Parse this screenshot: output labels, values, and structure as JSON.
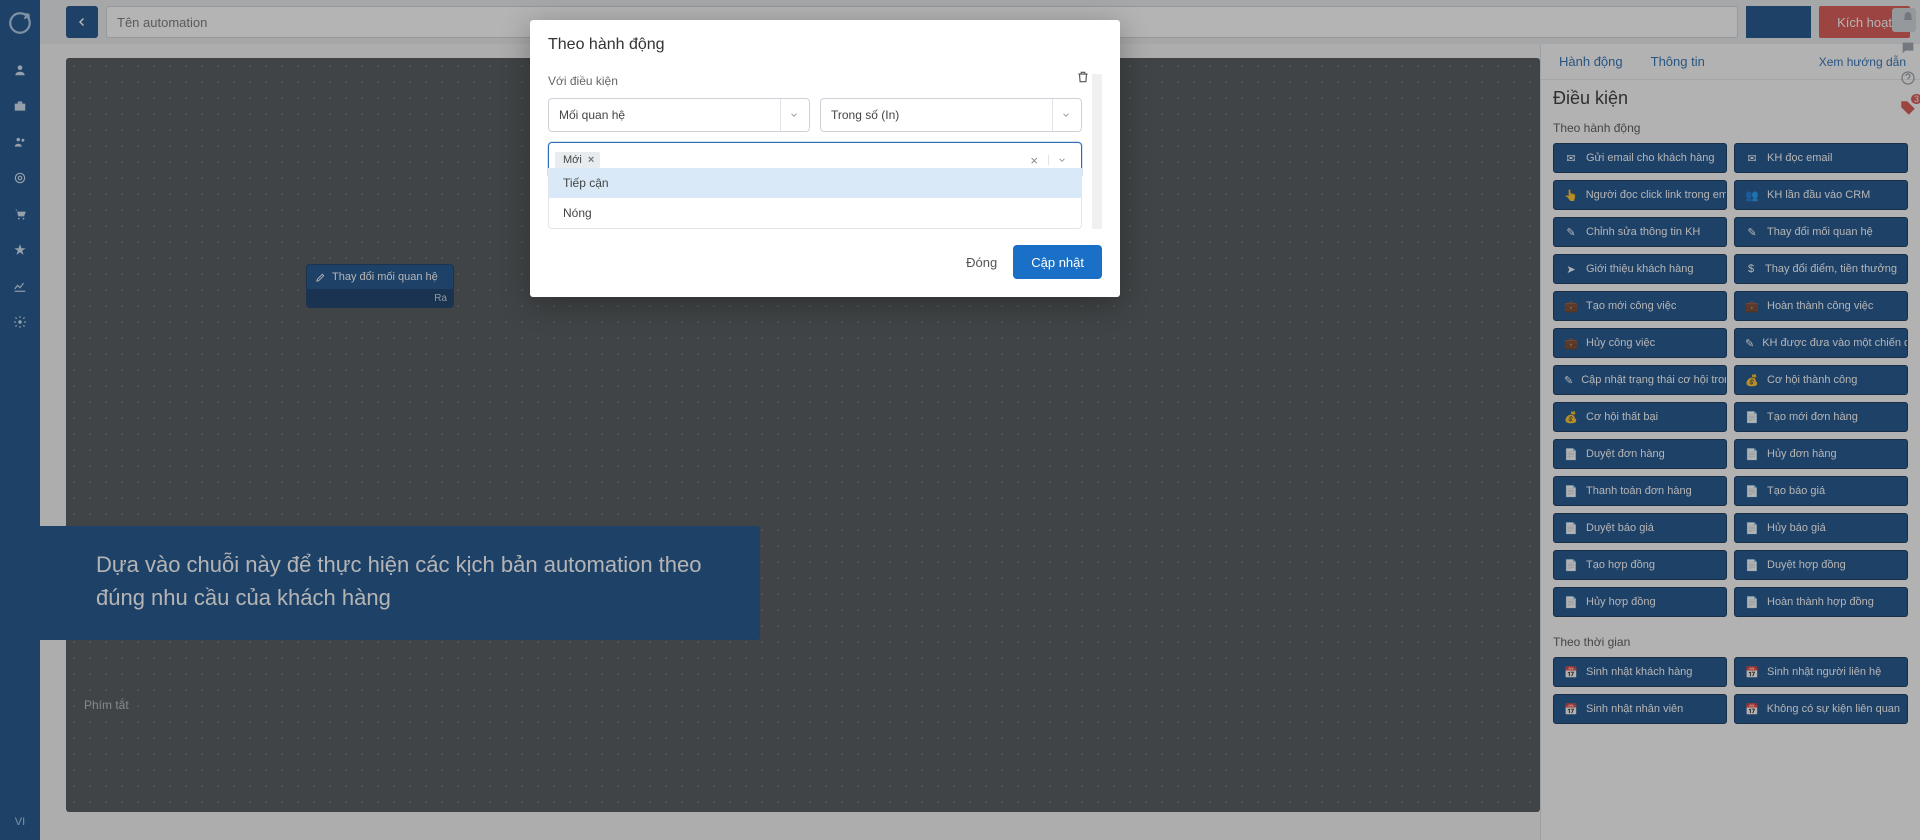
{
  "sidebar": {
    "lang": "VI"
  },
  "topbar": {
    "name_placeholder": "Tên automation",
    "activate": "Kích hoạt"
  },
  "canvas": {
    "node_label": "Thay đổi mối quan hệ",
    "node_port": "Ra",
    "shortcut": "Phím tắt"
  },
  "caption": "Dựa vào chuỗi này để thực hiện các kịch bản automation theo đúng nhu cầu của khách hàng",
  "panel": {
    "tabs": [
      "Hành động",
      "Thông tin"
    ],
    "help": "Xem hướng dẫn",
    "title": "Điều kiện",
    "section_action": "Theo hành động",
    "section_time": "Theo thời gian",
    "actions_col1": [
      {
        "icon": "✉",
        "label": "Gửi email cho khách hàng"
      },
      {
        "icon": "👆",
        "label": "Người đọc click link trong email"
      },
      {
        "icon": "✎",
        "label": "Chỉnh sửa thông tin KH"
      },
      {
        "icon": "➤",
        "label": "Giới thiệu khách hàng"
      },
      {
        "icon": "💼",
        "label": "Tạo mới công việc"
      },
      {
        "icon": "💼",
        "label": "Hủy công việc"
      },
      {
        "icon": "✎",
        "label": "Cập nhật trạng thái cơ hội trong …"
      },
      {
        "icon": "💰",
        "label": "Cơ hội thất bại"
      },
      {
        "icon": "📄",
        "label": "Duyệt đơn hàng"
      },
      {
        "icon": "📄",
        "label": "Thanh toán đơn hàng"
      },
      {
        "icon": "📄",
        "label": "Duyệt báo giá"
      },
      {
        "icon": "📄",
        "label": "Tạo hợp đồng"
      },
      {
        "icon": "📄",
        "label": "Hủy hợp đồng"
      }
    ],
    "actions_col2": [
      {
        "icon": "✉",
        "label": "KH đọc email"
      },
      {
        "icon": "👥",
        "label": "KH lần đầu vào CRM"
      },
      {
        "icon": "✎",
        "label": "Thay đổi mối quan hệ"
      },
      {
        "icon": "$",
        "label": "Thay đổi điểm, tiền thưởng"
      },
      {
        "icon": "💼",
        "label": "Hoàn thành công việc"
      },
      {
        "icon": "✎",
        "label": "KH được đưa vào một chiến dịch"
      },
      {
        "icon": "💰",
        "label": "Cơ hội thành công"
      },
      {
        "icon": "📄",
        "label": "Tạo mới đơn hàng"
      },
      {
        "icon": "📄",
        "label": "Hủy đơn hàng"
      },
      {
        "icon": "📄",
        "label": "Tạo báo giá"
      },
      {
        "icon": "📄",
        "label": "Hủy báo giá"
      },
      {
        "icon": "📄",
        "label": "Duyệt hợp đồng"
      },
      {
        "icon": "📄",
        "label": "Hoàn thành hợp đồng"
      }
    ],
    "time_col1": [
      {
        "icon": "📅",
        "label": "Sinh nhật khách hàng"
      },
      {
        "icon": "📅",
        "label": "Sinh nhật nhân viên"
      }
    ],
    "time_col2": [
      {
        "icon": "📅",
        "label": "Sinh nhật người liên hệ"
      },
      {
        "icon": "📅",
        "label": "Không có sự kiện liên quan"
      }
    ]
  },
  "modal": {
    "title": "Theo hành động",
    "cond_label": "Với điều kiện",
    "field_select": "Mối quan hệ",
    "op_select": "Trong số (In)",
    "chip": "Mới",
    "options": [
      "Tiếp cận",
      "Nóng"
    ],
    "close": "Đóng",
    "submit": "Cập nhật"
  },
  "floaters": {
    "badge": "3"
  }
}
